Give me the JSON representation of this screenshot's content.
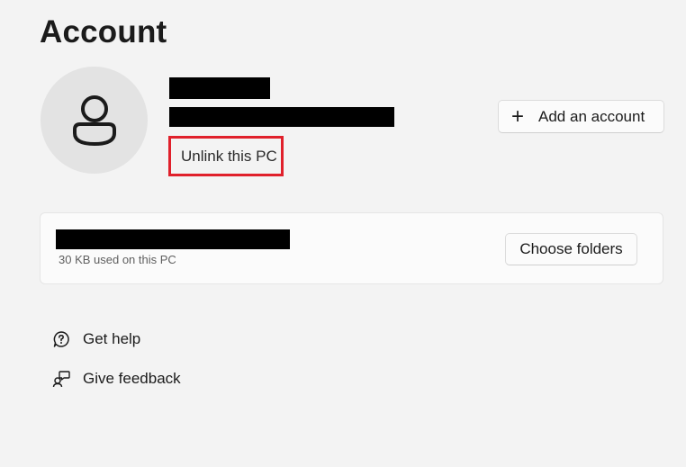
{
  "page": {
    "title": "Account"
  },
  "account": {
    "avatar_icon": "person-icon",
    "unlink_label": "Unlink this PC",
    "add_account_label": "Add an account",
    "add_icon": "plus-icon"
  },
  "storage": {
    "usage_text": "30 KB used on this PC",
    "choose_folders_label": "Choose folders"
  },
  "links": {
    "help": {
      "label": "Get help",
      "icon": "help-icon"
    },
    "feedback": {
      "label": "Give feedback",
      "icon": "feedback-icon"
    }
  },
  "colors": {
    "highlight_border": "#e0202b",
    "background": "#f3f3f3",
    "card": "#fbfbfb"
  }
}
